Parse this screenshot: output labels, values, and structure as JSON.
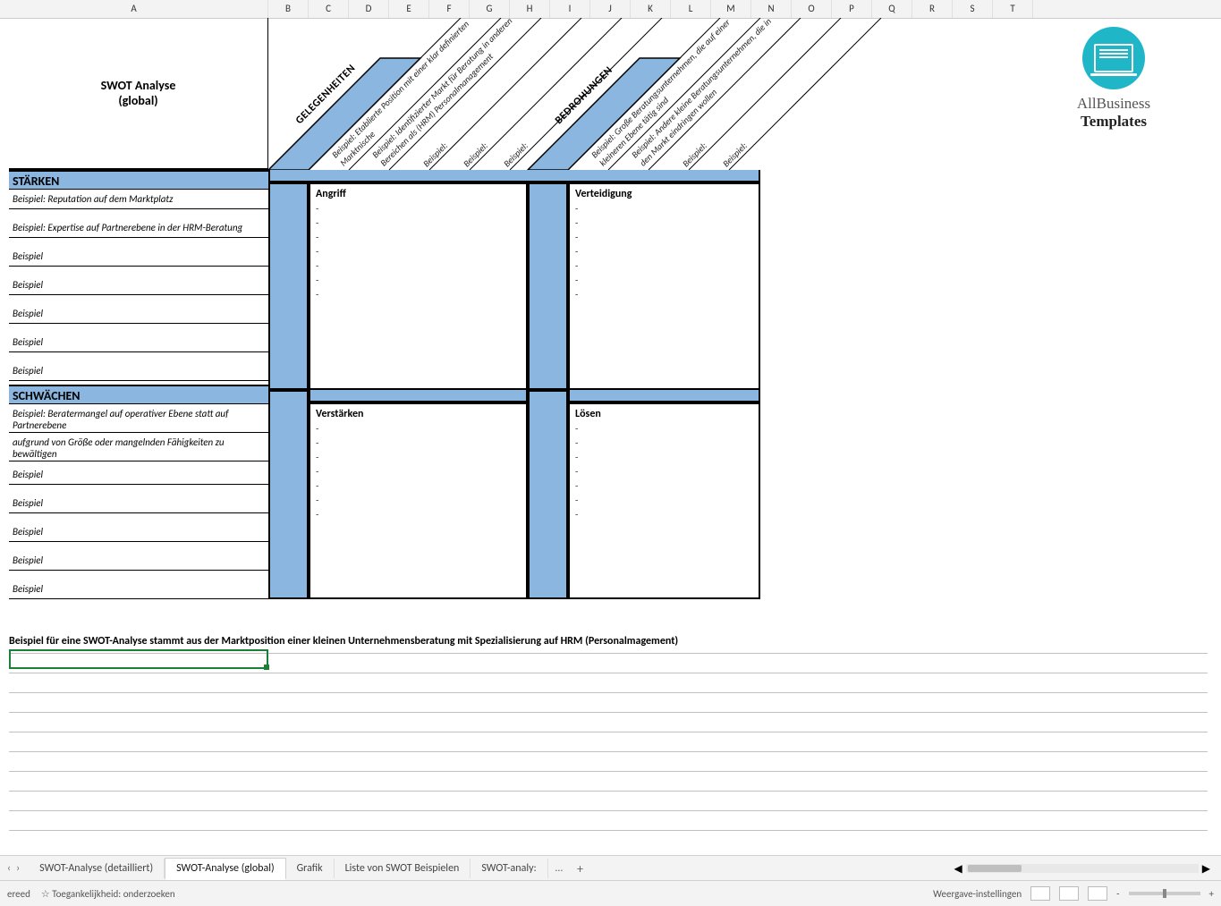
{
  "columns": [
    "A",
    "B",
    "C",
    "D",
    "E",
    "F",
    "G",
    "H",
    "I",
    "J",
    "K",
    "L",
    "M",
    "N",
    "O",
    "P",
    "Q",
    "R",
    "S",
    "T"
  ],
  "title": {
    "line1": "SWOT Analyse",
    "line2": "(global)"
  },
  "diag": {
    "opp_head": "GELEGENHEITEN",
    "thr_head": "BEDROHUNGEN",
    "opp": [
      "Beispiel: Etablierte Position mit einer klar definierten Marktnische",
      "Beispiel: Identifizierter Markt für Beratung in anderen Bereichen als (HRM) Personalmanagement",
      "Beispiel:",
      "Beispiel:",
      "Beispiel:"
    ],
    "thr": [
      "Beispiel: Große Beratungsunternehmen, die auf einer kleineren Ebene tätig sind",
      "Beispiel: Andere kleine Beratungsunternehmen, die in den Markt eindringen wollen",
      "Beispiel:",
      "Beispiel:"
    ]
  },
  "logo": {
    "brand": "AllBusiness",
    "sub": "Templates"
  },
  "staerken": {
    "head": "STÄRKEN",
    "rows": [
      "Beispiel: Reputation auf dem Marktplatz",
      "Beispiel: Expertise auf Partnerebene in der HRM-Beratung",
      "Beispiel",
      "Beispiel",
      "Beispiel",
      "Beispiel",
      "Beispiel"
    ]
  },
  "schwaechen": {
    "head": "SCHWÄCHEN",
    "rows": [
      "Beispiel: Beratermangel auf operativer Ebene statt auf Partnerebene",
      "aufgrund von Größe oder mangelnden Fähigkeiten zu bewältigen",
      "Beispiel",
      "Beispiel",
      "Beispiel",
      "Beispiel",
      "Beispiel"
    ]
  },
  "quadrants": {
    "angriff": "Angriff",
    "verteidigung": "Verteidigung",
    "verstaerken": "Verstärken",
    "loesen": "Lösen"
  },
  "dash": "-",
  "example_note": "Beispiel für eine SWOT-Analyse stammt aus der Marktposition einer kleinen Unternehmensberatung mit Spezialisierung auf HRM (Personalmagement)",
  "tabs": {
    "list": [
      "SWOT-Analyse (detailliert)",
      "SWOT-Analyse (global)",
      "Grafik",
      "Liste von SWOT Beispielen",
      "SWOT-analy:"
    ],
    "active": 1,
    "more": "…",
    "plus": "+",
    "nav_prev": "‹",
    "nav_next": "›"
  },
  "statusbar": {
    "ready": "ereed",
    "access": "☆ Toegankelijkheid: onderzoeken",
    "view": "Weergave-instellingen",
    "zoom_minus": "-",
    "zoom_plus": "+"
  }
}
